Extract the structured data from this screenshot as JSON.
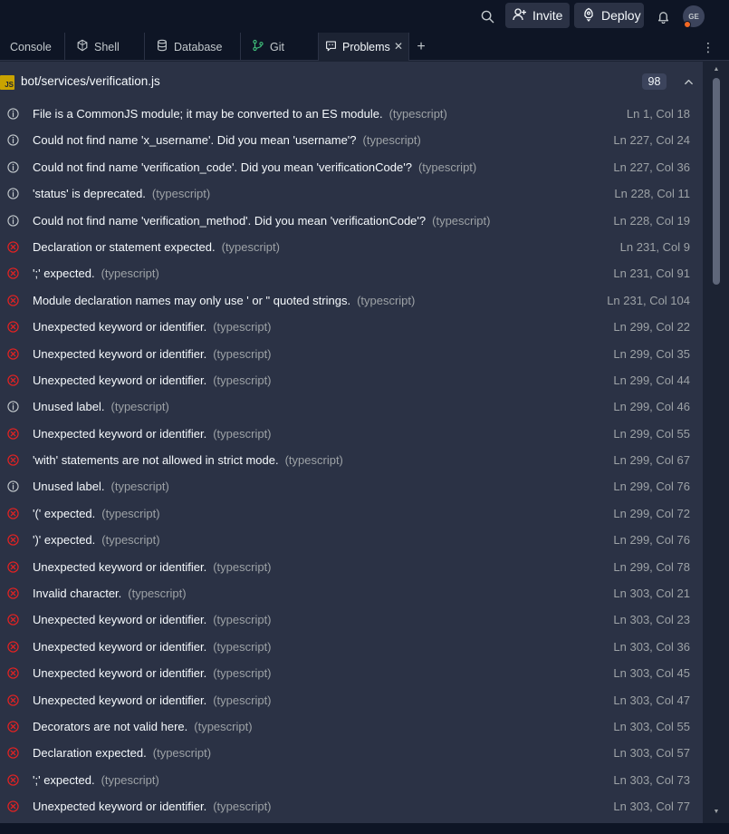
{
  "topbar": {
    "search_icon": "search-icon",
    "invite_label": "Invite",
    "deploy_label": "Deploy",
    "bell_icon": "bell-icon",
    "avatar_initials": "GE"
  },
  "tabs": [
    {
      "label": "Console",
      "icon": "terminal-icon"
    },
    {
      "label": "Shell",
      "icon": "shell-icon"
    },
    {
      "label": "Database",
      "icon": "database-icon"
    },
    {
      "label": "Git",
      "icon": "git-icon"
    },
    {
      "label": "Problems",
      "icon": "problems-icon",
      "active": true
    }
  ],
  "file": {
    "badge": "JS",
    "path": "bot/services/verification.js",
    "count": "98"
  },
  "problems": [
    {
      "severity": "info",
      "message": "File is a CommonJS module; it may be converted to an ES module.",
      "source": "(typescript)",
      "location": "Ln 1, Col 18"
    },
    {
      "severity": "info",
      "message": "Could not find name 'x_username'. Did you mean 'username'?",
      "source": "(typescript)",
      "location": "Ln 227, Col 24"
    },
    {
      "severity": "info",
      "message": "Could not find name 'verification_code'. Did you mean 'verificationCode'?",
      "source": "(typescript)",
      "location": "Ln 227, Col 36"
    },
    {
      "severity": "info",
      "message": "'status' is deprecated.",
      "source": "(typescript)",
      "location": "Ln 228, Col 11"
    },
    {
      "severity": "info",
      "message": "Could not find name 'verification_method'. Did you mean 'verificationCode'?",
      "source": "(typescript)",
      "location": "Ln 228, Col 19"
    },
    {
      "severity": "error",
      "message": "Declaration or statement expected.",
      "source": "(typescript)",
      "location": "Ln 231, Col 9"
    },
    {
      "severity": "error",
      "message": "';' expected.",
      "source": "(typescript)",
      "location": "Ln 231, Col 91"
    },
    {
      "severity": "error",
      "message": "Module declaration names may only use ' or \" quoted strings.",
      "source": "(typescript)",
      "location": "Ln 231, Col 104"
    },
    {
      "severity": "error",
      "message": "Unexpected keyword or identifier.",
      "source": "(typescript)",
      "location": "Ln 299, Col 22"
    },
    {
      "severity": "error",
      "message": "Unexpected keyword or identifier.",
      "source": "(typescript)",
      "location": "Ln 299, Col 35"
    },
    {
      "severity": "error",
      "message": "Unexpected keyword or identifier.",
      "source": "(typescript)",
      "location": "Ln 299, Col 44"
    },
    {
      "severity": "info",
      "message": "Unused label.",
      "source": "(typescript)",
      "location": "Ln 299, Col 46"
    },
    {
      "severity": "error",
      "message": "Unexpected keyword or identifier.",
      "source": "(typescript)",
      "location": "Ln 299, Col 55"
    },
    {
      "severity": "error",
      "message": "'with' statements are not allowed in strict mode.",
      "source": "(typescript)",
      "location": "Ln 299, Col 67"
    },
    {
      "severity": "info",
      "message": "Unused label.",
      "source": "(typescript)",
      "location": "Ln 299, Col 76"
    },
    {
      "severity": "error",
      "message": "'(' expected.",
      "source": "(typescript)",
      "location": "Ln 299, Col 72"
    },
    {
      "severity": "error",
      "message": "')' expected.",
      "source": "(typescript)",
      "location": "Ln 299, Col 76"
    },
    {
      "severity": "error",
      "message": "Unexpected keyword or identifier.",
      "source": "(typescript)",
      "location": "Ln 299, Col 78"
    },
    {
      "severity": "error",
      "message": "Invalid character.",
      "source": "(typescript)",
      "location": "Ln 303, Col 21"
    },
    {
      "severity": "error",
      "message": "Unexpected keyword or identifier.",
      "source": "(typescript)",
      "location": "Ln 303, Col 23"
    },
    {
      "severity": "error",
      "message": "Unexpected keyword or identifier.",
      "source": "(typescript)",
      "location": "Ln 303, Col 36"
    },
    {
      "severity": "error",
      "message": "Unexpected keyword or identifier.",
      "source": "(typescript)",
      "location": "Ln 303, Col 45"
    },
    {
      "severity": "error",
      "message": "Unexpected keyword or identifier.",
      "source": "(typescript)",
      "location": "Ln 303, Col 47"
    },
    {
      "severity": "error",
      "message": "Decorators are not valid here.",
      "source": "(typescript)",
      "location": "Ln 303, Col 55"
    },
    {
      "severity": "error",
      "message": "Declaration expected.",
      "source": "(typescript)",
      "location": "Ln 303, Col 57"
    },
    {
      "severity": "error",
      "message": "';' expected.",
      "source": "(typescript)",
      "location": "Ln 303, Col 73"
    },
    {
      "severity": "error",
      "message": "Unexpected keyword or identifier.",
      "source": "(typescript)",
      "location": "Ln 303, Col 77"
    }
  ],
  "colors": {
    "error": "#e52222",
    "info": "#c2c8cc",
    "accent_deploy": "#f5f9fc",
    "js_badge": "#c9a300",
    "avatar_status": "#f26722"
  }
}
